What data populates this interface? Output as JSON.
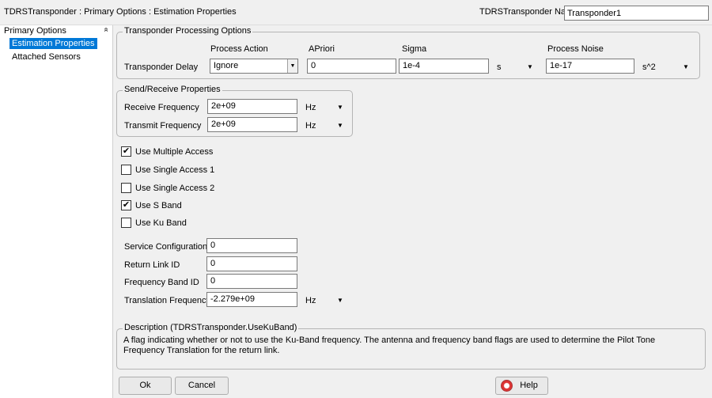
{
  "window": {
    "title": "TDRSTransponder : Primary Options : Estimation Properties",
    "name_label": "TDRSTransponder Name",
    "name_value": "Transponder1"
  },
  "sidebar": {
    "section_title": "Primary Options",
    "collapse_glyph": "»",
    "items": [
      {
        "label": "Estimation Properties"
      },
      {
        "label": "Attached Sensors"
      }
    ]
  },
  "processing": {
    "legend": "Transponder Processing Options",
    "col_process_action": "Process Action",
    "col_apriori": "APriori",
    "col_sigma": "Sigma",
    "col_process_noise": "Process Noise",
    "row_label": "Transponder Delay",
    "process_action": "Ignore",
    "apriori": "0",
    "sigma": "1e-4",
    "sigma_unit": "s",
    "process_noise": "1e-17",
    "process_noise_unit": "s^2"
  },
  "send_receive": {
    "legend": "Send/Receive Properties",
    "receive_label": "Receive Frequency",
    "receive_value": "2e+09",
    "receive_unit": "Hz",
    "transmit_label": "Transmit Frequency",
    "transmit_value": "2e+09",
    "transmit_unit": "Hz"
  },
  "checkboxes": [
    {
      "label": "Use Multiple Access",
      "checked": true
    },
    {
      "label": "Use Single Access 1",
      "checked": false
    },
    {
      "label": "Use Single Access 2",
      "checked": false
    },
    {
      "label": "Use S Band",
      "checked": true
    },
    {
      "label": "Use Ku Band",
      "checked": false
    }
  ],
  "config": {
    "service_label": "Service Configuration",
    "service_value": "0",
    "return_link_label": "Return Link ID",
    "return_link_value": "0",
    "freq_band_label": "Frequency Band ID",
    "freq_band_value": "0",
    "translation_label": "Translation Frequency",
    "translation_value": "-2.279e+09",
    "translation_unit": "Hz"
  },
  "description": {
    "legend": "Description (TDRSTransponder.UseKuBand)",
    "text": "A flag indicating whether or not to use the Ku-Band frequency.  The antenna and frequency band flags are used to determine the Pilot Tone Frequency Translation for the return link."
  },
  "buttons": {
    "ok": "Ok",
    "cancel": "Cancel",
    "help": "Help"
  },
  "glyphs": {
    "dropdown": "▼",
    "check": "✔"
  },
  "colors": {
    "selection": "#0078d7",
    "background": "#f0f0f0"
  }
}
